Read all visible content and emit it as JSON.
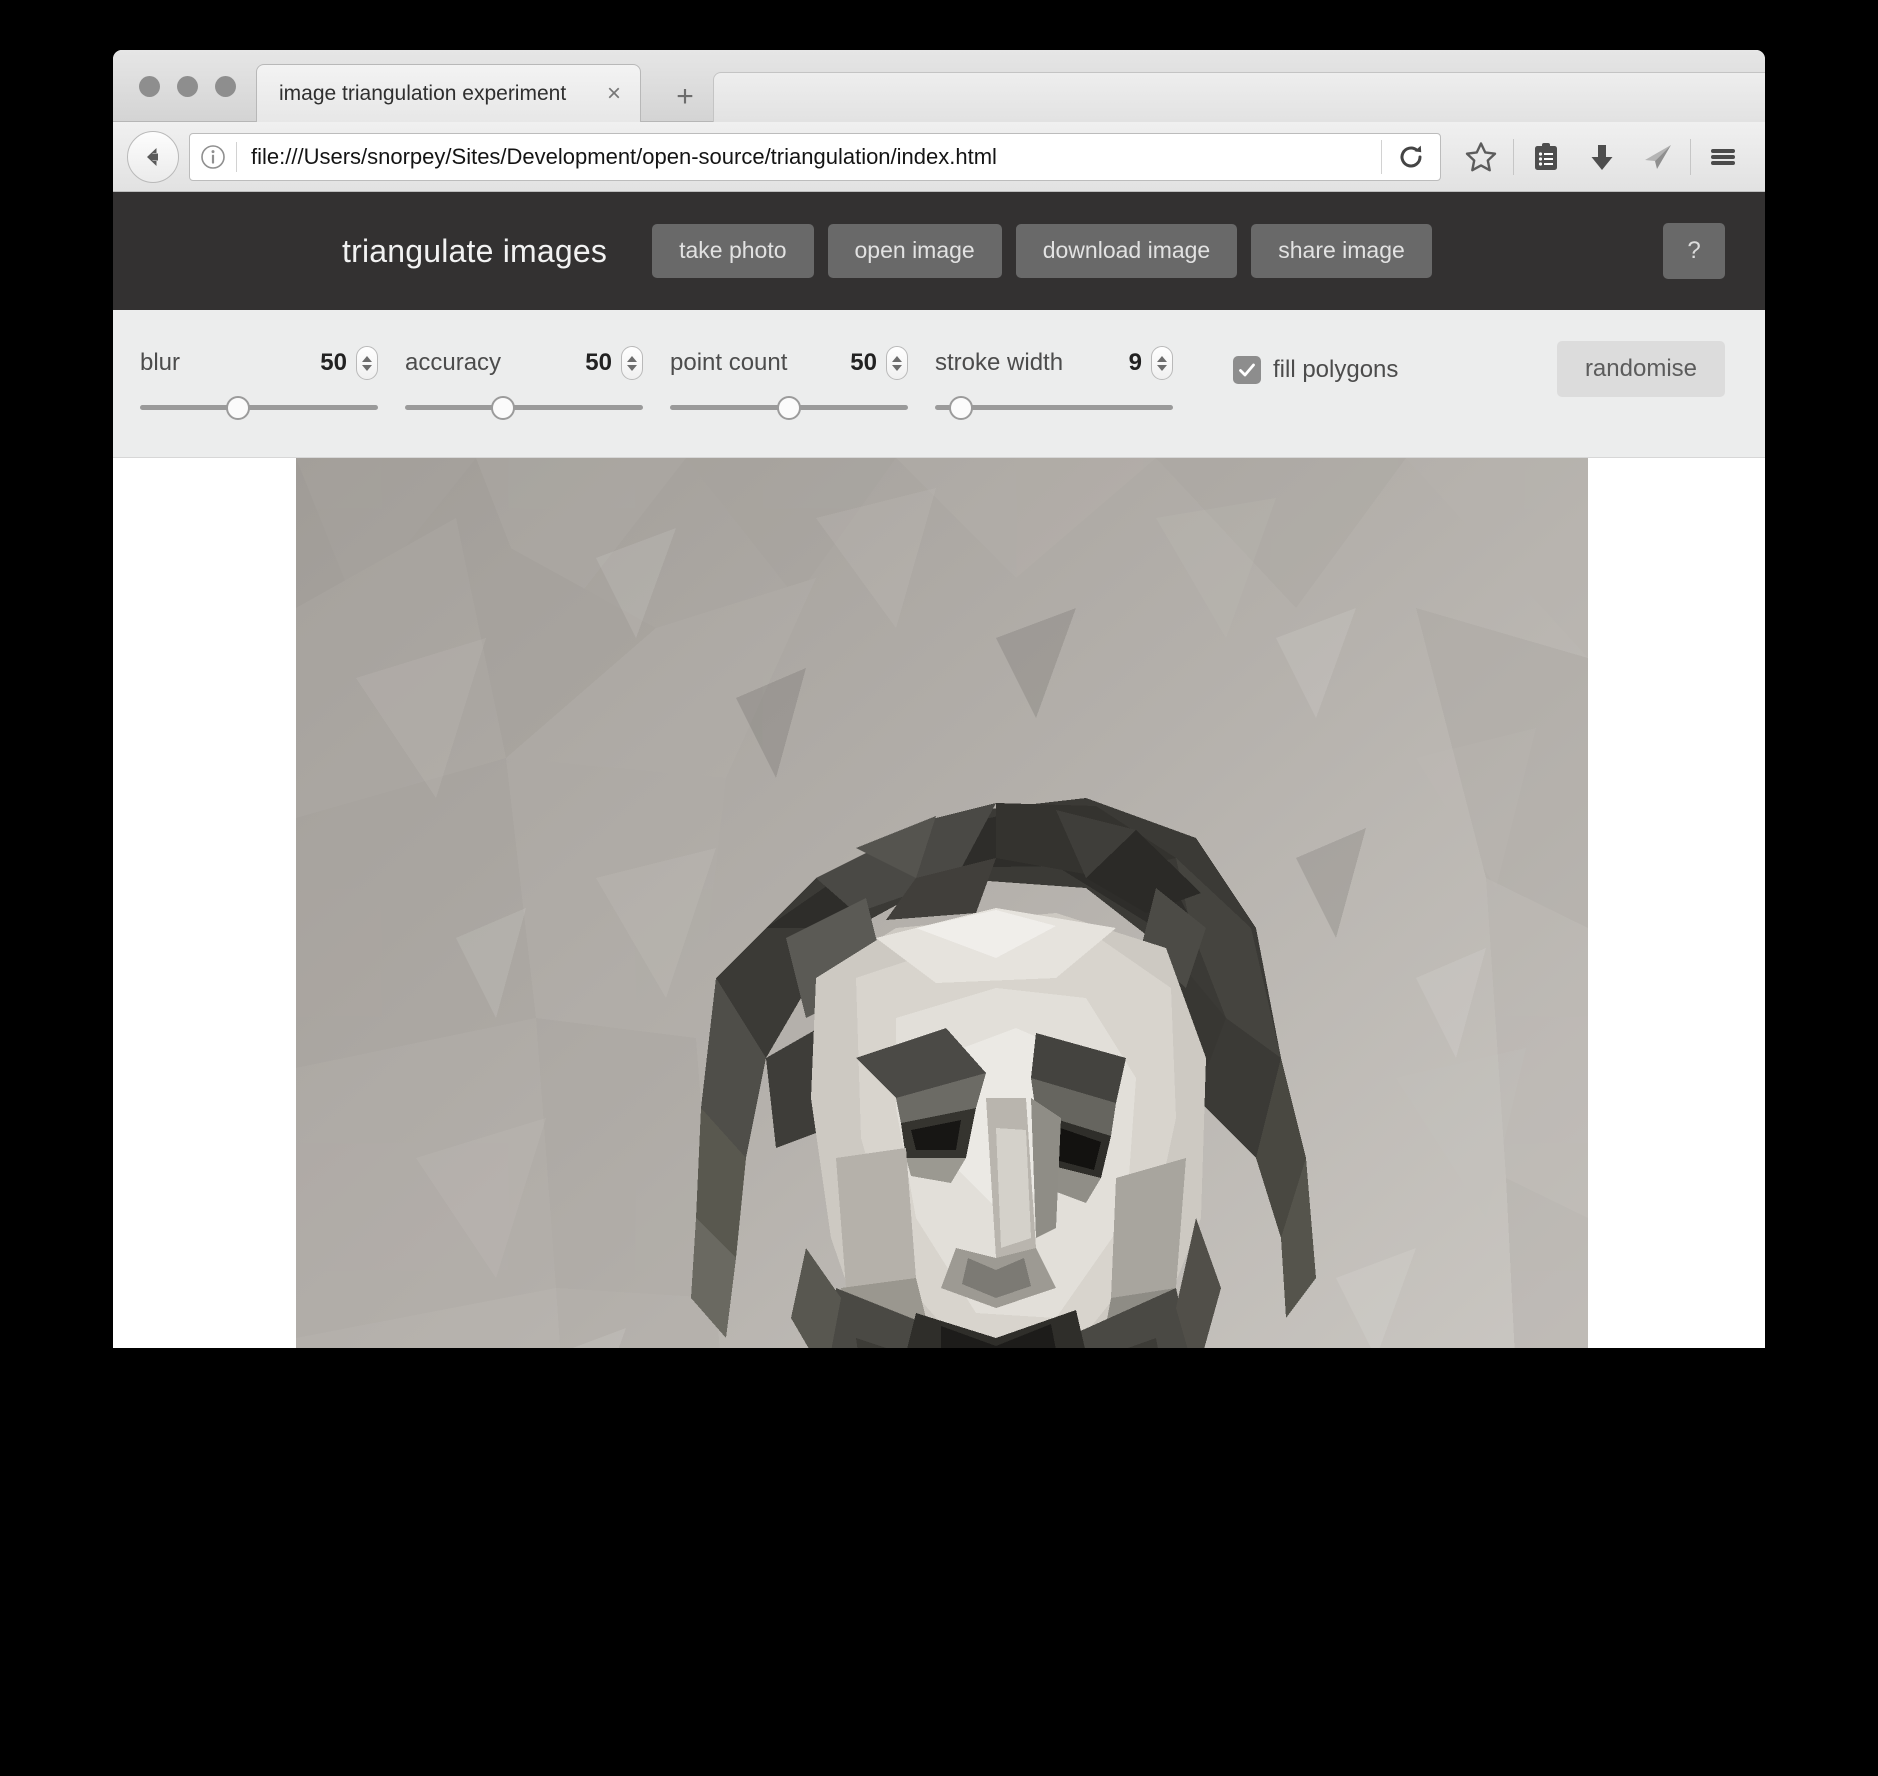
{
  "window": {
    "traffic_lights": [
      "close",
      "minimize",
      "zoom"
    ]
  },
  "browser": {
    "tab": {
      "title": "image triangulation experiment",
      "close_label": "×"
    },
    "new_tab_label": "+",
    "nav": {
      "back_label": "back",
      "info_label": "site information",
      "url": "file:///Users/snorpey/Sites/Development/open-source/triangulation/index.html",
      "reload_label": "reload"
    },
    "toolbar_icons": [
      "star-icon",
      "reading-list-icon",
      "download-icon",
      "send-icon",
      "menu-icon"
    ]
  },
  "app": {
    "title": "triangulate images",
    "buttons": [
      {
        "label": "take photo",
        "name": "take-photo-button"
      },
      {
        "label": "open image",
        "name": "open-image-button"
      },
      {
        "label": "download image",
        "name": "download-image-button"
      },
      {
        "label": "share image",
        "name": "share-image-button"
      }
    ],
    "help_label": "?"
  },
  "controls": {
    "sliders": [
      {
        "label": "blur",
        "value": "50",
        "percent": 41
      },
      {
        "label": "accuracy",
        "value": "50",
        "percent": 41
      },
      {
        "label": "point count",
        "value": "50",
        "percent": 50
      },
      {
        "label": "stroke width",
        "value": "9",
        "percent": 11
      }
    ],
    "fill_polygons": {
      "label": "fill polygons",
      "checked": true
    },
    "randomise_label": "randomise"
  },
  "colors": {
    "app_header_bg": "#333131",
    "header_button_bg": "#696969",
    "controls_bg": "#eceded",
    "randomise_bg": "#dcdcdc",
    "checkbox_bg": "#8d8d8d",
    "canvas_bg": "#ffffff"
  },
  "canvas": {
    "description": "low-poly triangulated black and white portrait of a bearded man in a dark suit",
    "background": "#a7a39e"
  }
}
